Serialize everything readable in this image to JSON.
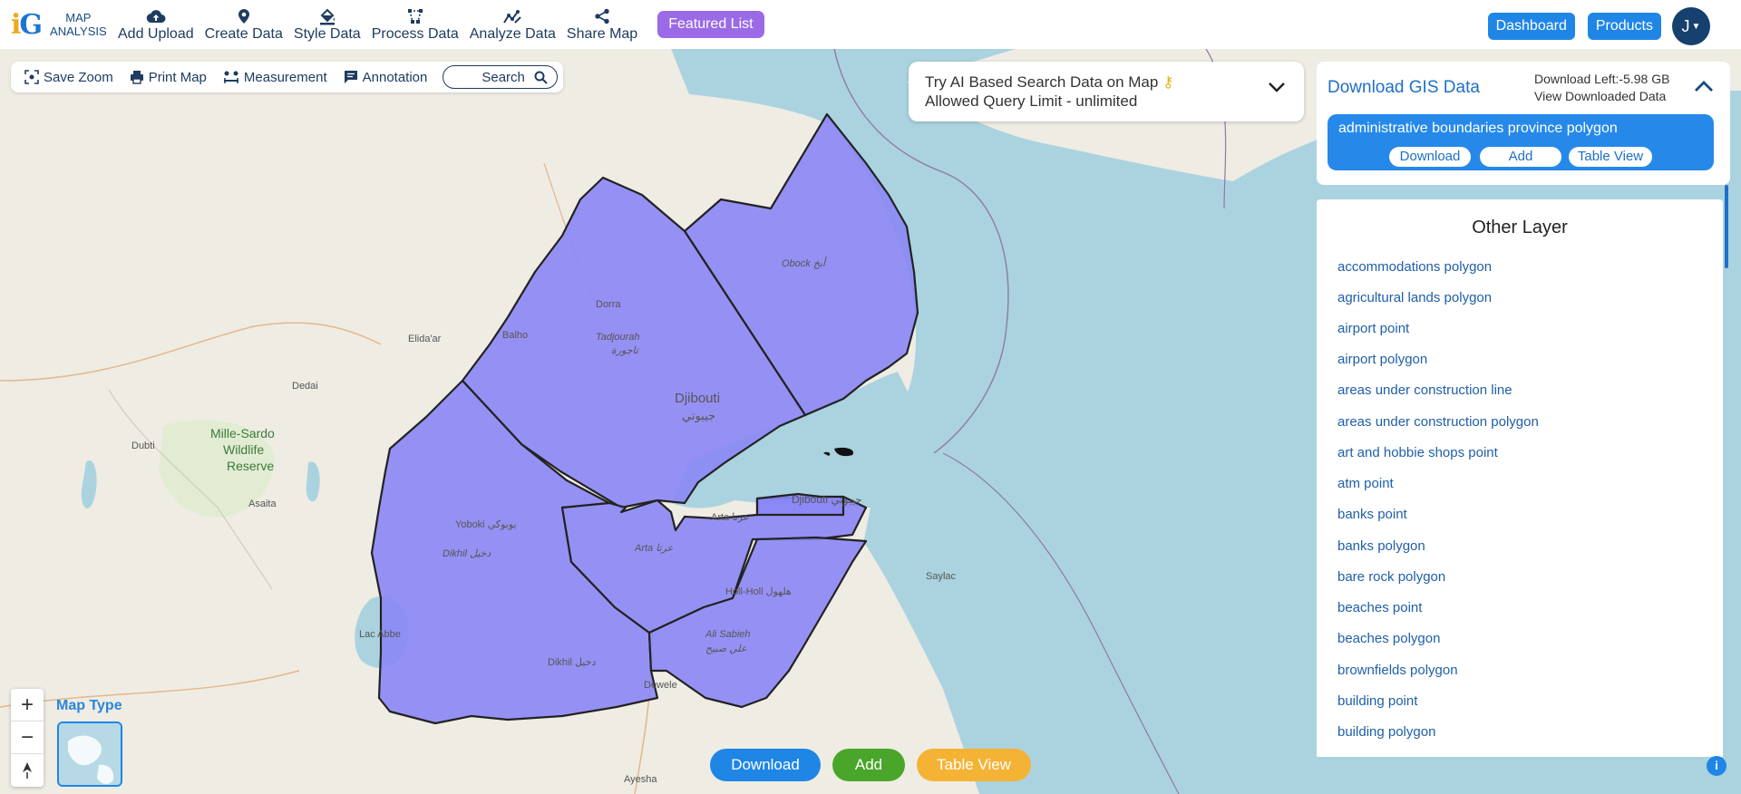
{
  "app": {
    "logo_mark": "iG",
    "logo_line1": "MAP",
    "logo_line2": "ANALYSIS"
  },
  "toolbar": {
    "items": [
      {
        "label": "Add Upload",
        "icon": "cloud-upload-icon"
      },
      {
        "label": "Create Data",
        "icon": "map-pin-icon"
      },
      {
        "label": "Style Data",
        "icon": "paint-bucket-icon"
      },
      {
        "label": "Process Data",
        "icon": "vector-path-icon"
      },
      {
        "label": "Analyze Data",
        "icon": "analytics-icon"
      },
      {
        "label": "Share Map",
        "icon": "share-icon"
      }
    ],
    "featured": "Featured List",
    "dashboard": "Dashboard",
    "products": "Products",
    "avatar": "J"
  },
  "map_tools": {
    "save_zoom": "Save Zoom",
    "print_map": "Print Map",
    "measurement": "Measurement",
    "annotation": "Annotation",
    "search": "Search"
  },
  "ai_search": {
    "line1": "Try AI Based Search Data on Map",
    "line2": "Allowed Query Limit - unlimited"
  },
  "download_panel": {
    "title": "Download GIS Data",
    "download_left": "Download Left:-5.98 GB",
    "view_downloaded": "View Downloaded Data",
    "layer_title": "administrative boundaries province polygon",
    "download": "Download",
    "add": "Add",
    "table_view": "Table View"
  },
  "other_layer": {
    "title": "Other Layer",
    "items": [
      "accommodations polygon",
      "agricultural lands polygon",
      "airport point",
      "airport polygon",
      "areas under construction line",
      "areas under construction polygon",
      "art and hobbie shops point",
      "atm point",
      "banks point",
      "banks polygon",
      "bare rock polygon",
      "beaches point",
      "beaches polygon",
      "brownfields polygon",
      "building point",
      "building polygon"
    ]
  },
  "map": {
    "map_type": "Map Type",
    "zoom_in": "+",
    "zoom_out": "−",
    "labels": {
      "obock": "Obock أبخ",
      "dorra": "Dorra",
      "tadjourah": "Tadjourah",
      "tadjourah_ar": "تاجورة",
      "balho": "Balho",
      "djibouti": "Djibouti",
      "djibouti_ar": "جيبوتي",
      "elidaar": "Elida'ar",
      "dedai": "Dedai",
      "dubti": "Dubti",
      "asaita": "Asaita",
      "millesardo": "Mille-Sardo",
      "wildlife": "Wildlife",
      "reserve": "Reserve",
      "yoboki": "Yoboki يوبوكي",
      "dikhil": "Dikhil دخيل",
      "arta": "Arta عرتا",
      "arta2": "Arta عرتا",
      "holl": "Holl-Holl هلهول",
      "alisabieh": "Ali Sabieh",
      "alisabieh_ar": "علي صبيح",
      "dikhil2": "Dikhil دخيل",
      "dewele": "Dewele",
      "aysha": "Ayesha",
      "saylac": "Saylac",
      "djibouti_city": "Djibouti جيبوتي",
      "lacabbe": "Lac Abbe"
    }
  },
  "bottom": {
    "download": "Download",
    "add": "Add",
    "table_view": "Table View",
    "info": "i"
  },
  "colors": {
    "accent": "#1f86e6",
    "featured": "#9b6ae6",
    "add": "#4aa62a",
    "table_view": "#f5b335",
    "polygon": "#8b87f5"
  }
}
